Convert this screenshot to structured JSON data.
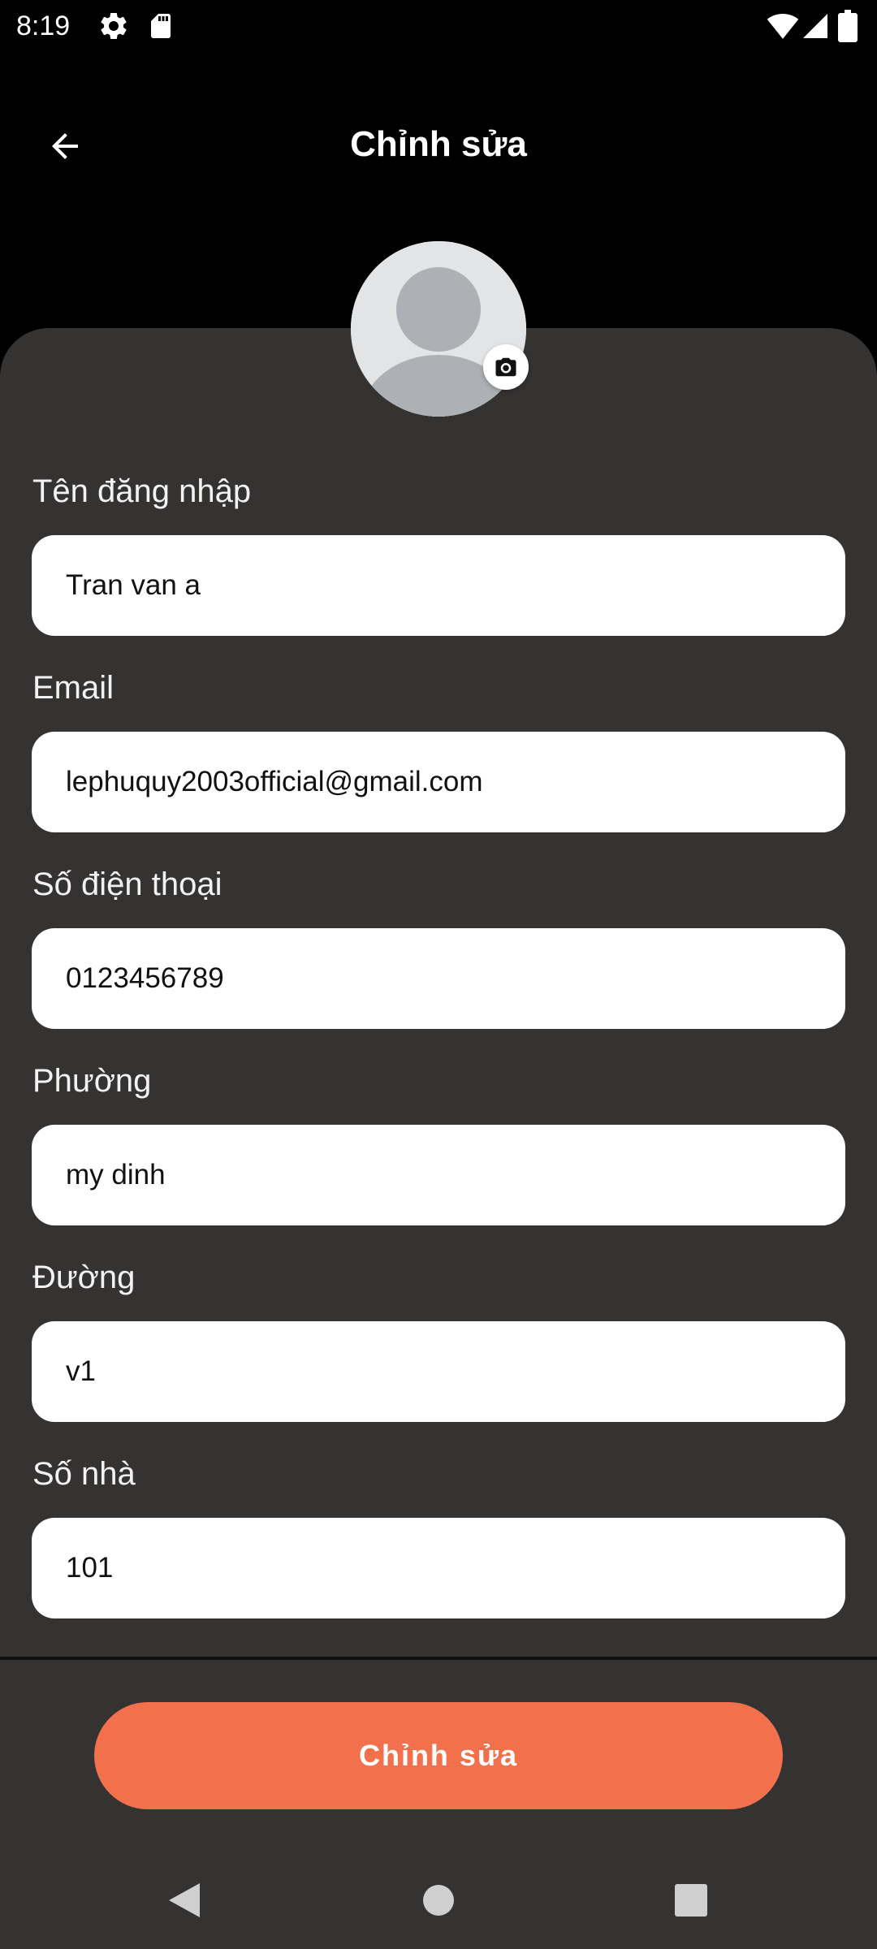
{
  "status_bar": {
    "time": "8:19",
    "icons": [
      "gear-icon",
      "sd-card-icon",
      "wifi-icon",
      "signal-icon",
      "battery-icon"
    ]
  },
  "header": {
    "title": "Chỉnh sửa",
    "back_icon": "arrow-left-icon"
  },
  "profile": {
    "avatar_icon": "person-avatar-icon",
    "camera_icon": "camera-icon"
  },
  "form": {
    "fields": [
      {
        "label": "Tên đăng nhập",
        "value": "Tran van a"
      },
      {
        "label": "Email",
        "value": "lephuquy2003official@gmail.com"
      },
      {
        "label": "Số điện thoại",
        "value": "0123456789"
      },
      {
        "label": "Phường",
        "value": "my dinh"
      },
      {
        "label": "Đường",
        "value": "v1"
      },
      {
        "label": "Số nhà",
        "value": "101"
      }
    ]
  },
  "actions": {
    "submit_label": "Chỉnh sửa"
  },
  "navigation": {
    "icons": [
      "back-triangle-icon",
      "home-circle-icon",
      "recents-square-icon"
    ]
  },
  "colors": {
    "background": "#000000",
    "panel": "#353232",
    "accent": "#f2714c",
    "input_background": "#ffffff"
  }
}
